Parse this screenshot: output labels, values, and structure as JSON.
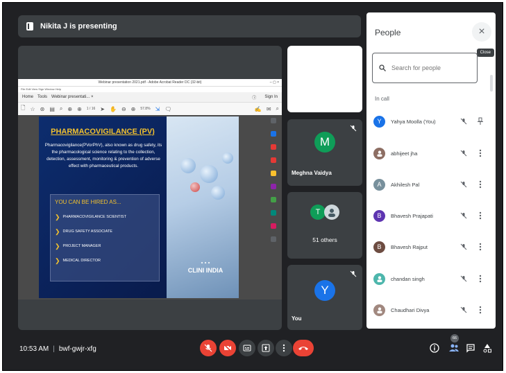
{
  "header": {
    "presenting_text": "Nikita J is presenting"
  },
  "acrobat": {
    "window_title": "Webinar presentation 2021.pdf - Adobe Acrobat Reader DC (32-bit)",
    "menu": "File  Edit  View  Sign  Window  Help",
    "tab_home": "Home",
    "tab_tools": "Tools",
    "tab_doc": "Webinar presentati... ×",
    "sign_in": "Sign In",
    "page_field": "1 / 16",
    "zoom": "57.8%"
  },
  "slide": {
    "title": "PHARMACOVIGILANCE (PV)",
    "description": "Pharmacovigilance(PVorPhV), also known as drug safety, its the pharmacological science relating to the collection, detection, assessment, monitoring & prevention of adverse effect with pharmaceutical products.",
    "hired_title": "YOU CAN BE HIRED AS...",
    "roles": [
      "PHARMACOVIGILANCE SCIENTIST",
      "DRUG SAFETY ASSOCIATE",
      "PROJECT MANAGER",
      "MEDICAL DIRECTOR"
    ],
    "logo_text": "CLINI INDIA"
  },
  "tiles": {
    "meghna": {
      "initial": "M",
      "name": "Meghna Vaidya",
      "color": "#0f9d58"
    },
    "others": {
      "initial": "T",
      "label": "51 others",
      "color": "#0f9d58"
    },
    "you": {
      "initial": "Y",
      "name": "You",
      "color": "#1a73e8"
    }
  },
  "people_panel": {
    "title": "People",
    "close_tooltip": "Close",
    "search_placeholder": "Search for people",
    "section": "In call",
    "people": [
      {
        "name": "Yahya Moolla (You)",
        "initial": "Y",
        "color": "#1a73e8",
        "photo": false
      },
      {
        "name": "abhijeet jha",
        "initial": "",
        "color": "#8d6e63",
        "photo": true
      },
      {
        "name": "Akhilesh Pal",
        "initial": "A",
        "color": "#78909c",
        "photo": false
      },
      {
        "name": "Bhavesh Prajapati",
        "initial": "B",
        "color": "#5e35b1",
        "photo": false
      },
      {
        "name": "Bhavesh Rajput",
        "initial": "B",
        "color": "#6d4c41",
        "photo": false
      },
      {
        "name": "chandan singh",
        "initial": "",
        "color": "#4db6ac",
        "photo": true
      },
      {
        "name": "Chaudhari Divya",
        "initial": "",
        "color": "#a1887f",
        "photo": true
      }
    ]
  },
  "bottom_bar": {
    "time": "10:53 AM",
    "meeting_code": "bwf-gwjr-xfg",
    "people_count": "66"
  }
}
